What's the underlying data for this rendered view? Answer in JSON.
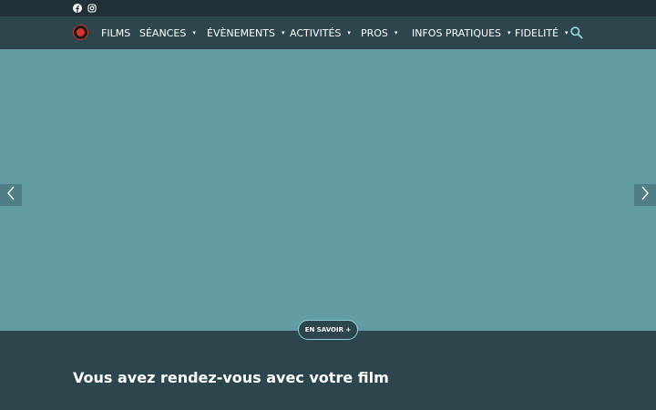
{
  "topbar": {
    "social": [
      {
        "icon": "facebook-icon"
      },
      {
        "icon": "instagram-icon"
      }
    ]
  },
  "nav": {
    "logo_icon": "cinema-logo-icon",
    "items": [
      {
        "label": "FILMS",
        "has_dropdown": false
      },
      {
        "label": "SÉANCES",
        "has_dropdown": true
      },
      {
        "label": "ÉVÈNEMENTS",
        "has_dropdown": true
      },
      {
        "label": "ACTIVITÉS",
        "has_dropdown": true
      },
      {
        "label": "PROS",
        "has_dropdown": true
      },
      {
        "label": "INFOS PRATIQUES",
        "has_dropdown": true
      },
      {
        "label": "FIDELITÉ",
        "has_dropdown": true
      }
    ],
    "caret": "▾",
    "search_icon": "search-icon"
  },
  "hero": {
    "background_color": "#639ba2",
    "prev_icon": "chevron-left-icon",
    "next_icon": "chevron-right-icon",
    "cta_label": "EN SAVOIR +"
  },
  "section": {
    "headline": "Vous avez rendez-vous avec votre film"
  },
  "colors": {
    "topbar": "#1f3137",
    "navbar": "#2d454c",
    "accent": "#8fd0d6"
  }
}
